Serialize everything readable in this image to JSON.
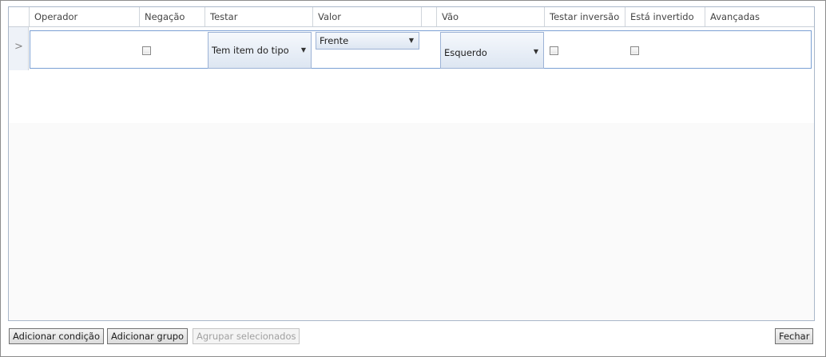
{
  "grid": {
    "columns": [
      "Operador",
      "Negação",
      "Testar",
      "Valor",
      "",
      "Vão",
      "Testar inversão",
      "Está invertido",
      "Avançadas"
    ]
  },
  "row": {
    "indicator": ">",
    "testar_value": "Tem item do tipo",
    "valor_value": "Frente",
    "vao_value": "Esquerdo",
    "dropdown_arrow": "▼"
  },
  "buttons": {
    "add_condition": "Adicionar condição",
    "add_group": "Adicionar grupo",
    "group_selected": "Agrupar selecionados",
    "close": "Fechar"
  }
}
